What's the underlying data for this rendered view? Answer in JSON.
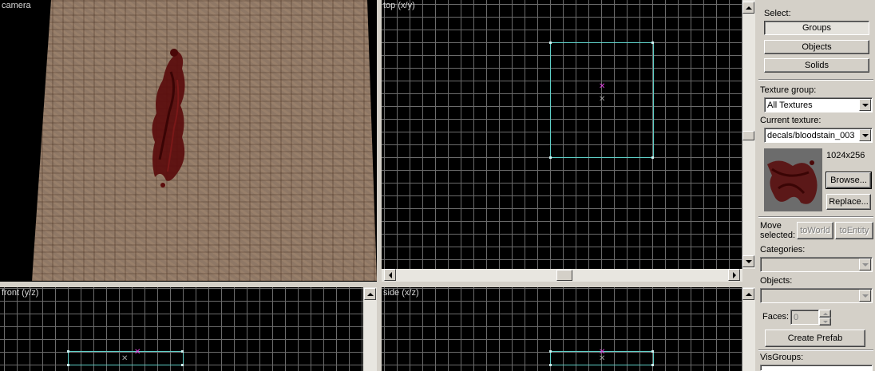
{
  "viewports": {
    "camera": {
      "label": "camera"
    },
    "top": {
      "label": "top (x/y)"
    },
    "front": {
      "label": "front (y/z)"
    },
    "side": {
      "label": "side (x/z)"
    }
  },
  "panel": {
    "select_label": "Select:",
    "groups_label": "Groups",
    "objects_label": "Objects",
    "solids_label": "Solids",
    "texture_group_label": "Texture group:",
    "texture_group_value": "All Textures",
    "current_texture_label": "Current texture:",
    "current_texture_value": "decals/bloodstain_003",
    "texture_size": "1024x256",
    "browse_label": "Browse...",
    "replace_label": "Replace...",
    "move_label": "Move",
    "selected_label": "selected:",
    "to_world_label": "toWorld",
    "to_entity_label": "toEntity",
    "categories_label": "Categories:",
    "categories_value": "",
    "objects_field_label": "Objects:",
    "objects_field_value": "",
    "faces_label": "Faces:",
    "faces_value": "0",
    "create_prefab_label": "Create Prefab",
    "visgroups_label": "VisGroups:"
  },
  "colors": {
    "brush_outline": "#5fd0c8",
    "origin_marker": "#e040e0",
    "grid_line": "#6b6b6b",
    "panel_bg": "#d4d0c8"
  }
}
